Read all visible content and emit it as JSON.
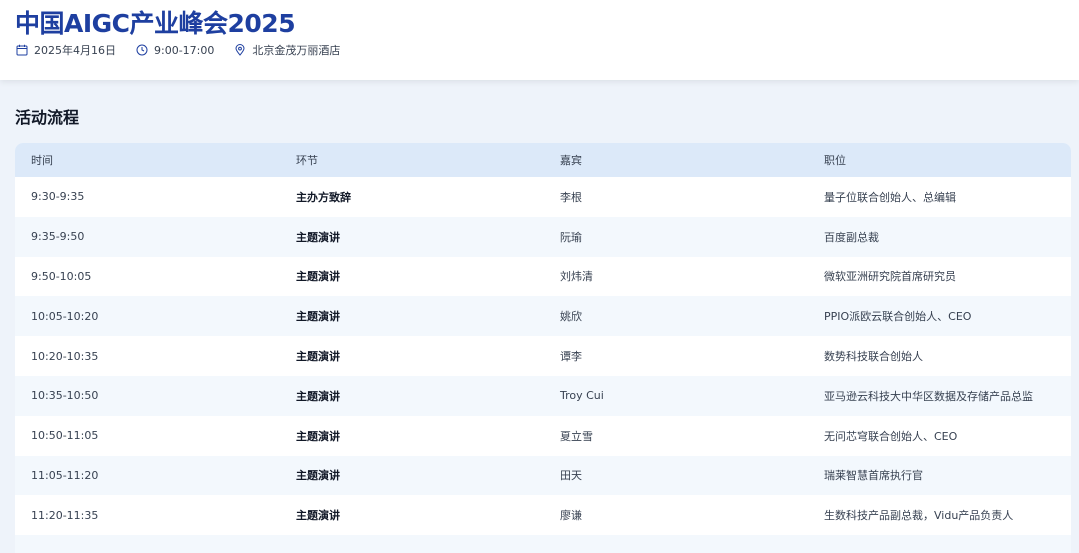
{
  "header": {
    "title": "中国AIGC产业峰会2025",
    "date": "2025年4月16日",
    "time": "9:00-17:00",
    "location": "北京金茂万丽酒店",
    "icons": {
      "date": "calendar-icon",
      "time": "clock-icon",
      "location": "location-pin-icon"
    }
  },
  "colors": {
    "accent": "#1e3fa0",
    "table_header_bg": "#dce9f9",
    "page_bg": "#eef3fa"
  },
  "schedule": {
    "title": "活动流程",
    "columns": [
      "时间",
      "环节",
      "嘉宾",
      "职位"
    ],
    "rows": [
      [
        "9:30-9:35",
        "主办方致辞",
        "李根",
        "量子位联合创始人、总编辑"
      ],
      [
        "9:35-9:50",
        "主题演讲",
        "阮瑜",
        "百度副总裁"
      ],
      [
        "9:50-10:05",
        "主题演讲",
        "刘炜清",
        "微软亚洲研究院首席研究员"
      ],
      [
        "10:05-10:20",
        "主题演讲",
        "姚欣",
        "PPIO派欧云联合创始人、CEO"
      ],
      [
        "10:20-10:35",
        "主题演讲",
        "谭李",
        "数势科技联合创始人"
      ],
      [
        "10:35-10:50",
        "主题演讲",
        "Troy Cui",
        "亚马逊云科技大中华区数据及存储产品总监"
      ],
      [
        "10:50-11:05",
        "主题演讲",
        "夏立雪",
        "无问芯穹联合创始人、CEO"
      ],
      [
        "11:05-11:20",
        "主题演讲",
        "田天",
        "瑞莱智慧首席执行官"
      ],
      [
        "11:20-11:35",
        "主题演讲",
        "廖谦",
        "生数科技产品副总裁，Vidu产品负责人"
      ]
    ]
  }
}
